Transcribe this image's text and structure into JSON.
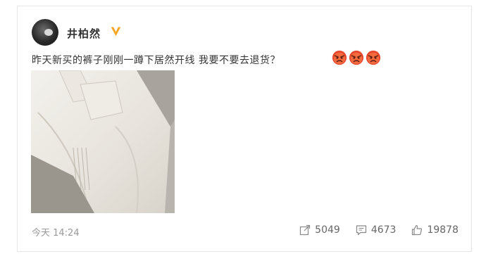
{
  "post": {
    "author": "井柏然",
    "text": "昨天新买的裤子刚刚一蹲下居然开线 我要不要去退货？",
    "emojis": [
      "angry-face",
      "angry-face",
      "angry-face"
    ],
    "time": "今天 14:24",
    "photo_alt": "裤子开线照片"
  },
  "stats": {
    "reposts": "5049",
    "comments": "4673",
    "likes": "19878"
  },
  "colors": {
    "verified_badge": "#f5a623",
    "emoji_red": "#e8452c",
    "meta_gray": "#999999"
  }
}
